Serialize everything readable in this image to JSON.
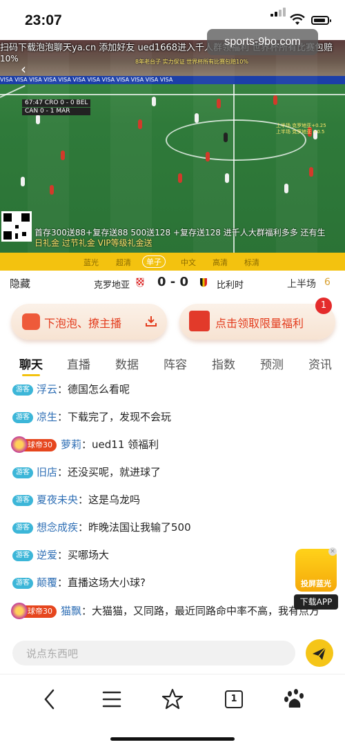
{
  "status": {
    "time": "23:07"
  },
  "video": {
    "site_badge": "sports-9bo.com",
    "top_marquee": "扫码下载泡泡聊天ya.cn 添加好友 ued1668进入千人群领福利 世界杯所有比赛包赔",
    "top_marquee_2": "10%",
    "promo_line": "8年老台子 实力保证 世界杯所有比赛包赔10%",
    "score_rows": [
      "67:47 CRO 0 - 0 BEL",
      "CAN 0 - 1 MAR"
    ],
    "adboard": "VISA  VISA  VISA  VISA  VISA  VISA  VISA  VISA  VISA  VISA  VISA  VISA",
    "right_info": [
      "上半场 克罗地亚+0.25",
      "上半场 克罗地亚 +0.5"
    ],
    "bottom_marquee_white": "首存300送88+复存送88 500送128 +复存送128 进千人大群福利多多 还有生",
    "bottom_marquee_yellow": "日礼金 过节礼金 VIP等级礼金送"
  },
  "quality": {
    "options": [
      "蓝光",
      "超清",
      "单子",
      "中文",
      "高清",
      "标清"
    ]
  },
  "match": {
    "hide_label": "隐藏",
    "team1": "克罗地亚",
    "score": "0 - 0",
    "team2": "比利时",
    "half_label": "上半场",
    "half_num": "6"
  },
  "promo": {
    "left_label": "下泡泡、撩主播",
    "right_label": "点击领取限量福利",
    "badge": "1"
  },
  "tabs": [
    "聊天",
    "直播",
    "数据",
    "阵容",
    "指数",
    "预测",
    "资讯"
  ],
  "chat": {
    "guest_tag": "游客",
    "vip_tag": "球帝30",
    "messages": [
      {
        "user": "浮云",
        "text": "：德国怎么看呢"
      },
      {
        "user": "凉生",
        "text": "：下载完了，发现不会玩"
      },
      {
        "user": "萝莉",
        "text": "：ued11 领福利"
      },
      {
        "user": "旧店",
        "text": "：还没买呢，就进球了"
      },
      {
        "user": "夏夜未央",
        "text": "：这是乌龙吗"
      },
      {
        "user": "想念成疾",
        "text": "：昨晚法国让我输了500"
      },
      {
        "user": "逆爱",
        "text": "：买哪场大"
      },
      {
        "user": "颠覆",
        "text": "：直播这场大小球?"
      },
      {
        "user": "猫飘",
        "text": "：大猫猫，又同路，最近同路命中率不高，我有点方"
      }
    ]
  },
  "float_app": {
    "label": "投屏蓝光",
    "download": "下载APP"
  },
  "input": {
    "placeholder": "说点东西吧"
  },
  "nav": {
    "tab_count": "1"
  },
  "colors": {
    "accent": "#f3c20f",
    "promo_red": "#e33b1c",
    "guest_blue": "#3cb6d8",
    "vip_red": "#e6461e"
  }
}
